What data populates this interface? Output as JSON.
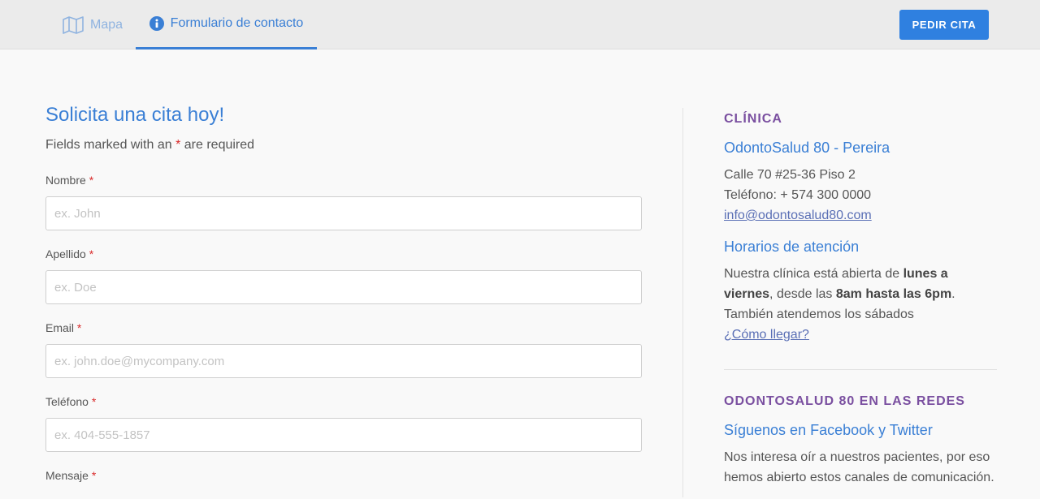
{
  "nav": {
    "tabs": [
      {
        "label": "Mapa",
        "icon": "map-icon"
      },
      {
        "label": "Formulario de contacto",
        "icon": "info-icon"
      }
    ],
    "cta_label": "PEDIR CITA"
  },
  "form": {
    "title": "Solicita una cita hoy!",
    "required_note_prefix": "Fields marked with an",
    "required_star": "*",
    "required_note_suffix": "are required",
    "fields": [
      {
        "label": "Nombre",
        "placeholder": "ex. John",
        "value": ""
      },
      {
        "label": "Apellido",
        "placeholder": "ex. Doe",
        "value": ""
      },
      {
        "label": "Email",
        "placeholder": "ex. john.doe@mycompany.com",
        "value": ""
      },
      {
        "label": "Teléfono",
        "placeholder": "ex. 404-555-1857",
        "value": ""
      },
      {
        "label": "Mensaje",
        "placeholder": "",
        "value": ""
      }
    ]
  },
  "sidebar": {
    "clinic_heading": "CLÍNICA",
    "clinic_name": "OdontoSalud 80 - Pereira",
    "address": "Calle 70 #25-36 Piso 2",
    "phone": "Teléfono: + 574 300 0000",
    "email": "info@odontosalud80.com",
    "hours_title": "Horarios de atención",
    "hours": {
      "t1": "Nuestra clínica está abierta de ",
      "b1": "lunes a viernes",
      "t2": ", desde las ",
      "b2": "8am hasta las 6pm",
      "t3": ". También atendemos los sábados"
    },
    "directions_link": "¿Cómo llegar?",
    "social_heading": "ODONTOSALUD 80 EN LAS REDES",
    "social_title": "Síguenos en Facebook y Twitter",
    "social_text": "Nos interesa oír a nuestros pacientes, por eso hemos abierto estos canales de comunicación."
  },
  "colors": {
    "accent": "#3a7fd5",
    "button": "#2f80e0",
    "heading_purple": "#7a4fa0",
    "required_red": "#d92b2b"
  }
}
